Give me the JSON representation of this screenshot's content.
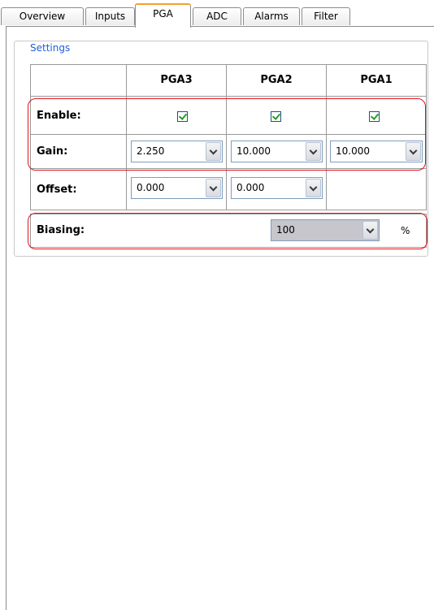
{
  "tabs": [
    {
      "label": "Overview",
      "active": false
    },
    {
      "label": "Inputs",
      "active": false
    },
    {
      "label": "PGA",
      "active": true
    },
    {
      "label": "ADC",
      "active": false
    },
    {
      "label": "Alarms",
      "active": false
    },
    {
      "label": "Filter",
      "active": false
    }
  ],
  "settings": {
    "group_title": "Settings",
    "columns": [
      "PGA3",
      "PGA2",
      "PGA1"
    ],
    "rows": {
      "enable": {
        "label": "Enable:",
        "checked": [
          true,
          true,
          true
        ]
      },
      "gain": {
        "label": "Gain:",
        "values": [
          "2.250",
          "10.000",
          "10.000"
        ]
      },
      "offset": {
        "label": "Offset:",
        "values": [
          "0.000",
          "0.000"
        ]
      }
    },
    "biasing": {
      "label": "Biasing:",
      "value": "100",
      "unit": "%"
    }
  },
  "colors": {
    "highlight": "#e0141e",
    "active_tab_accent": "#f2a12e",
    "group_title": "#1f5fd6",
    "check_mark": "#21a121"
  }
}
